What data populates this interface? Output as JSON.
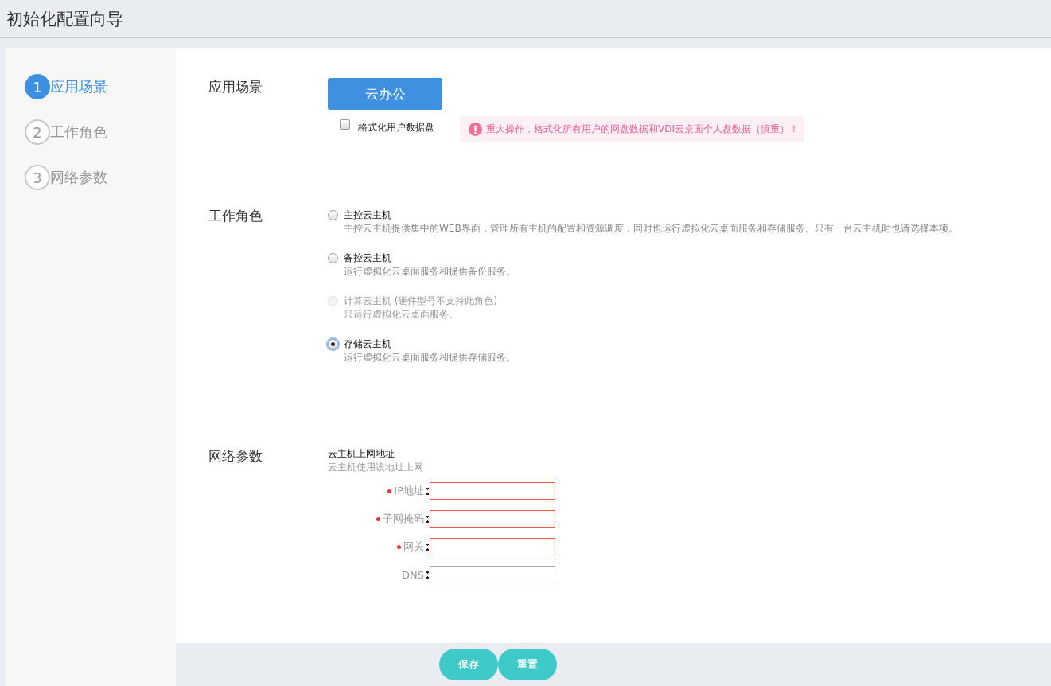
{
  "header": {
    "title": "初始化配置向导"
  },
  "steps": [
    {
      "number": "1",
      "label": "应用场景",
      "selected": true
    },
    {
      "number": "2",
      "label": "工作角色",
      "selected": false
    },
    {
      "number": "3",
      "label": "网络参数",
      "selected": false
    }
  ],
  "scenario": {
    "heading": "应用场景",
    "button": "云办公",
    "format_checkbox": {
      "label": "格式化用户数据盘",
      "checked": false
    },
    "warning": "重大操作，格式化所有用户的网盘数据和VDI云桌面个人盘数据（慎重）！"
  },
  "roles": {
    "heading": "工作角色",
    "options": [
      {
        "label": "主控云主机",
        "description": "主控云主机提供集中的WEB界面，管理所有主机的配置和资源调度，同时也运行虚拟化云桌面服务和存储服务。只有一台云主机时也请选择本项。",
        "selected": false,
        "disabled": false
      },
      {
        "label": "备控云主机",
        "description": "运行虚拟化云桌面服务和提供备份服务。",
        "selected": false,
        "disabled": false
      },
      {
        "label": "计算云主机 (硬件型号不支持此角色)",
        "description": "只运行虚拟化云桌面服务。",
        "selected": false,
        "disabled": true
      },
      {
        "label": "存储云主机",
        "description": "运行虚拟化云桌面服务和提供存储服务。",
        "selected": true,
        "disabled": false
      }
    ]
  },
  "network": {
    "heading": "网络参数",
    "title": "云主机上网地址",
    "subtitle": "云主机使用该地址上网",
    "fields": [
      {
        "label": "IP地址",
        "required": true
      },
      {
        "label": "子网掩码",
        "required": true
      },
      {
        "label": "网关",
        "required": true
      },
      {
        "label": "DNS",
        "required": false
      }
    ]
  },
  "footer": {
    "buttons": [
      "保存",
      "重置"
    ]
  }
}
